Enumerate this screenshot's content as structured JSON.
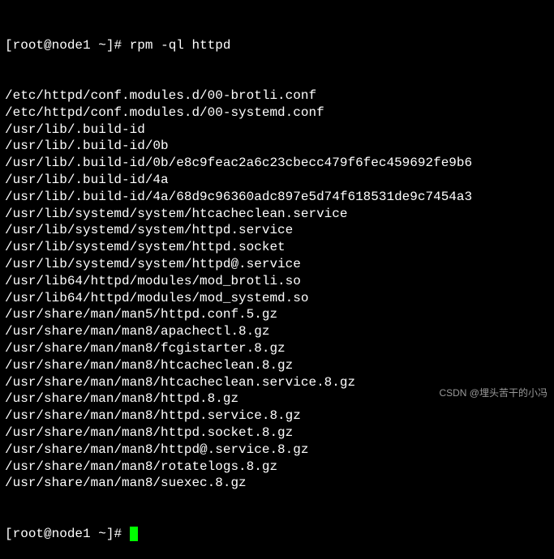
{
  "prompt_user": "root",
  "prompt_host": "node1",
  "prompt_path": "~",
  "prompt_symbol": "#",
  "command": "rpm -ql httpd",
  "output_lines": [
    "/etc/httpd/conf.modules.d/00-brotli.conf",
    "/etc/httpd/conf.modules.d/00-systemd.conf",
    "/usr/lib/.build-id",
    "/usr/lib/.build-id/0b",
    "/usr/lib/.build-id/0b/e8c9feac2a6c23cbecc479f6fec459692fe9b6",
    "/usr/lib/.build-id/4a",
    "/usr/lib/.build-id/4a/68d9c96360adc897e5d74f618531de9c7454a3",
    "/usr/lib/systemd/system/htcacheclean.service",
    "/usr/lib/systemd/system/httpd.service",
    "/usr/lib/systemd/system/httpd.socket",
    "/usr/lib/systemd/system/httpd@.service",
    "/usr/lib64/httpd/modules/mod_brotli.so",
    "/usr/lib64/httpd/modules/mod_systemd.so",
    "/usr/share/man/man5/httpd.conf.5.gz",
    "/usr/share/man/man8/apachectl.8.gz",
    "/usr/share/man/man8/fcgistarter.8.gz",
    "/usr/share/man/man8/htcacheclean.8.gz",
    "/usr/share/man/man8/htcacheclean.service.8.gz",
    "/usr/share/man/man8/httpd.8.gz",
    "/usr/share/man/man8/httpd.service.8.gz",
    "/usr/share/man/man8/httpd.socket.8.gz",
    "/usr/share/man/man8/httpd@.service.8.gz",
    "/usr/share/man/man8/rotatelogs.8.gz",
    "/usr/share/man/man8/suexec.8.gz"
  ],
  "watermark": "CSDN @埋头苦干的小冯"
}
